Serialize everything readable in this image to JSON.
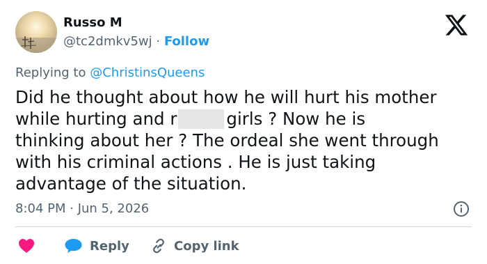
{
  "author": {
    "name": "Russo M",
    "handle": "@tc2dmkv5wj",
    "separator": "·",
    "follow_label": "Follow"
  },
  "reply_context": {
    "prefix": "Replying to",
    "mention": "@ChristinsQueens"
  },
  "tweet": {
    "line1": "Did he thought about how he will hurt his mother",
    "line2_before_redaction": "while hurting and r",
    "line2_after_redaction": "girls ?   Now he is",
    "line3": "thinking about her ?  The ordeal she went through",
    "line4": "with his criminal actions .  He is just taking",
    "line5": "advantage of the situation."
  },
  "meta": {
    "timestamp": "8:04 PM · Jun 5, 2026"
  },
  "actions": {
    "reply_label": "Reply",
    "copy_link_label": "Copy link"
  },
  "colors": {
    "accent": "#1d9bf0",
    "like": "#f91880",
    "secondary_text": "#536471",
    "text": "#0f1419"
  },
  "icons": {
    "logo": "x-logo-icon",
    "info": "info-icon",
    "like": "heart-icon",
    "reply": "speech-bubble-icon",
    "copy_link": "link-icon"
  }
}
